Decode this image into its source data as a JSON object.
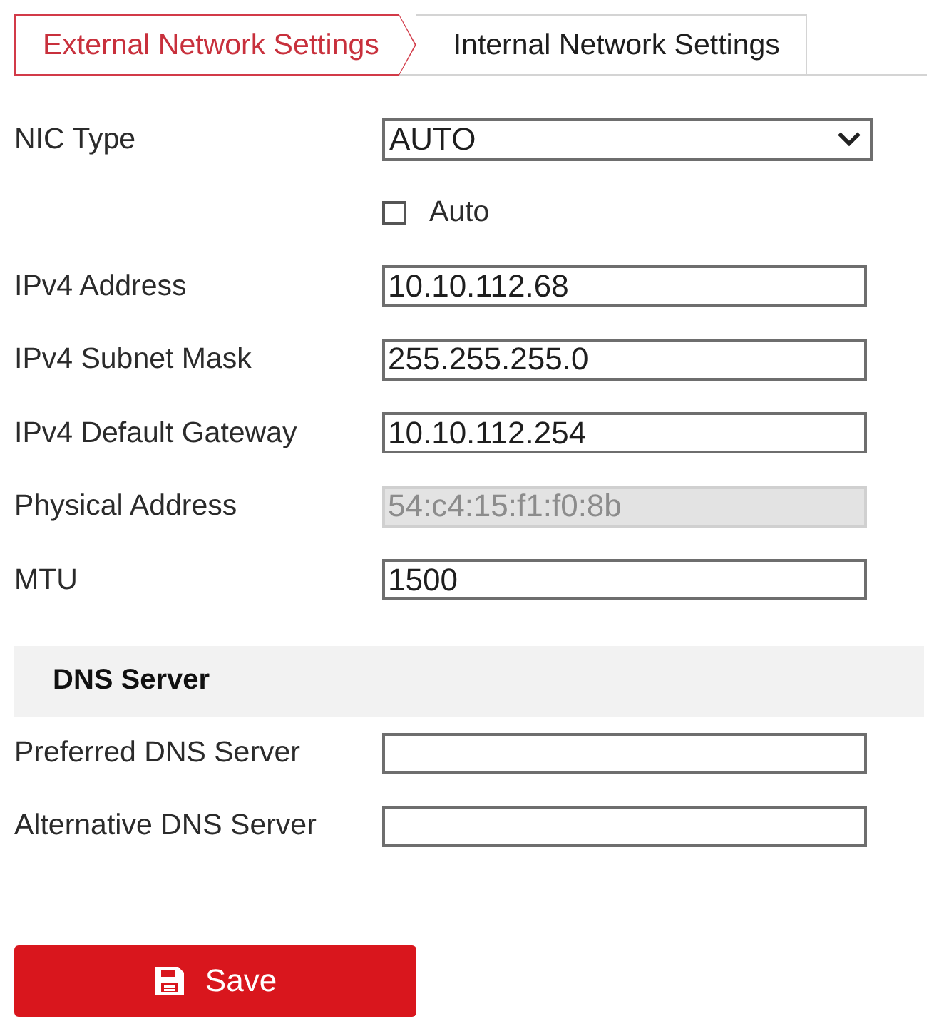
{
  "tabs": [
    {
      "label": "External Network Settings",
      "selected": true
    },
    {
      "label": "Internal Network Settings",
      "selected": false
    }
  ],
  "fields": [
    {
      "kind": "select",
      "label": "NIC Type",
      "value": "AUTO"
    },
    {
      "kind": "checkbox",
      "label": "Auto",
      "checked": false
    },
    {
      "kind": "text",
      "label": "IPv4 Address",
      "value": "10.10.112.68",
      "disabled": false
    },
    {
      "kind": "text",
      "label": "IPv4 Subnet Mask",
      "value": "255.255.255.0",
      "disabled": false
    },
    {
      "kind": "text",
      "label": "IPv4 Default Gateway",
      "value": "10.10.112.254",
      "disabled": false
    },
    {
      "kind": "text",
      "label": "Physical Address",
      "value": "54:c4:15:f1:f0:8b",
      "disabled": true
    },
    {
      "kind": "text",
      "label": "MTU",
      "value": "1500",
      "disabled": false
    }
  ],
  "dns_section": {
    "title": "DNS Server",
    "fields": [
      {
        "label": "Preferred DNS Server",
        "disabled": false
      },
      {
        "label": "Alternative DNS Server",
        "disabled": false
      }
    ]
  },
  "save_button": {
    "label": "Save"
  }
}
